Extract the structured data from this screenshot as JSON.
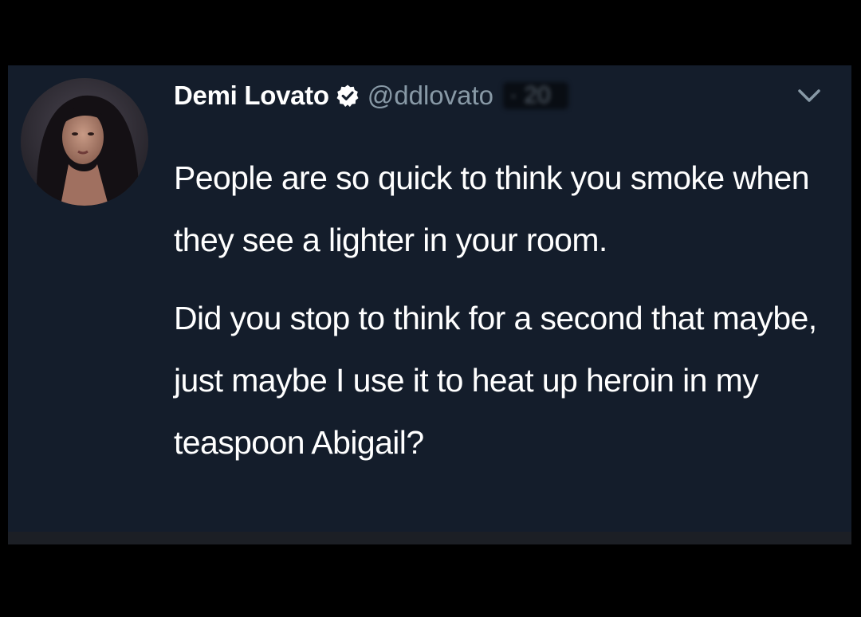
{
  "tweet": {
    "display_name": "Demi Lovato",
    "handle": "@ddlovato",
    "timestamp": "· 20",
    "verified": true,
    "paragraphs": [
      "People are so quick to think you smoke when they see a lighter in your room.",
      "Did you stop to think for a second that maybe, just maybe I use it to heat up heroin in my teaspoon Abigail?"
    ]
  },
  "icons": {
    "verified": "verified-badge-icon",
    "dropdown": "chevron-down-icon"
  },
  "colors": {
    "background": "#000000",
    "card": "#141d2b",
    "name_text": "#ffffff",
    "handle_text": "#8899a6",
    "body_text": "#ffffff",
    "verified_badge": "#ffffff"
  }
}
